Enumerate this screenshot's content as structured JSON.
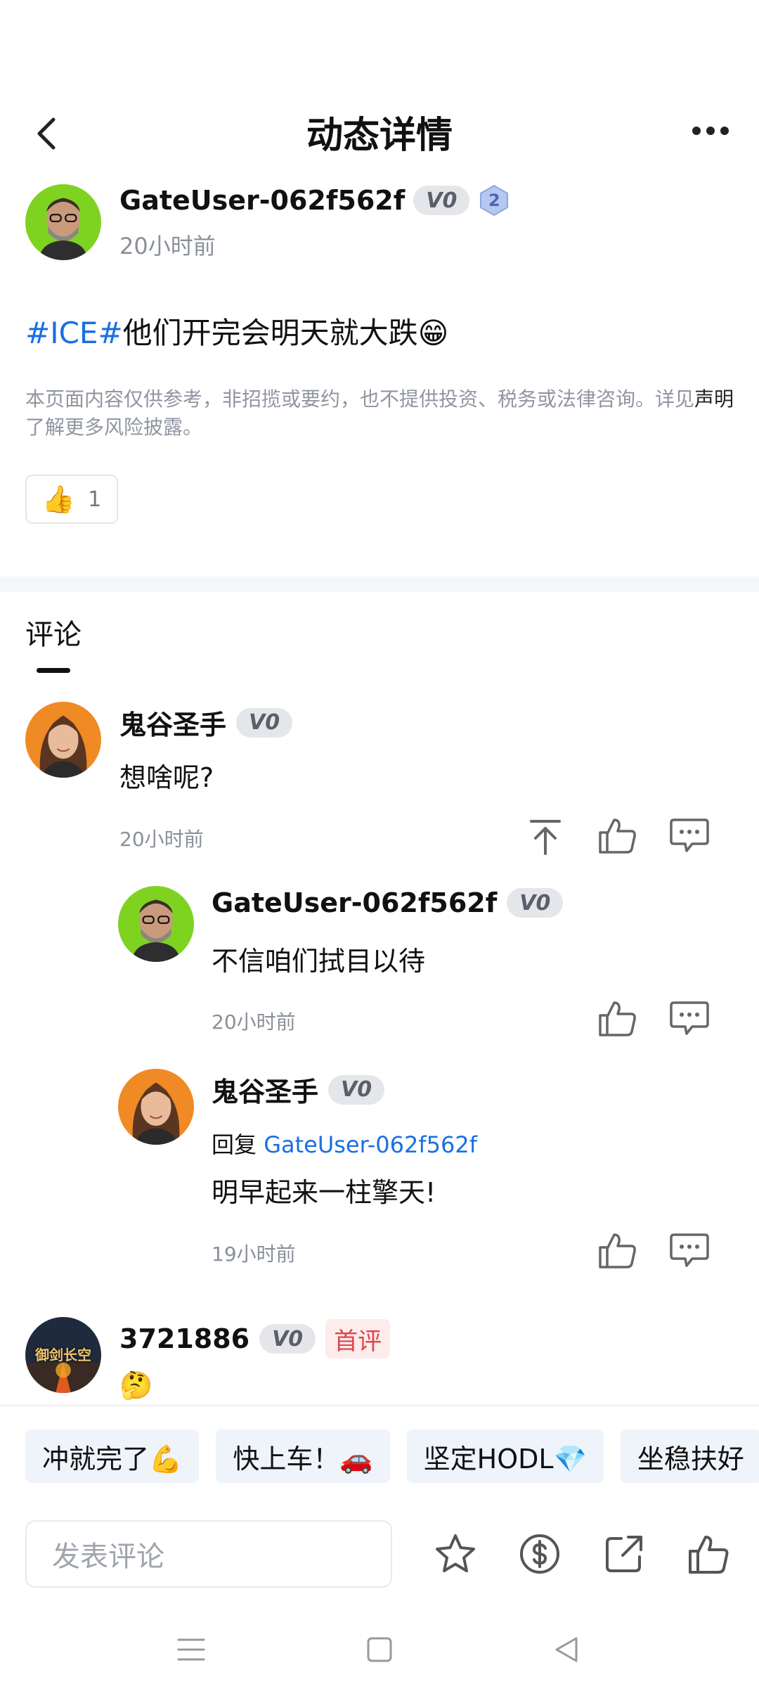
{
  "header": {
    "title": "动态详情"
  },
  "post": {
    "author": "GateUser-062f562f",
    "level": "V0",
    "badge_number": "2",
    "time": "20小时前",
    "tag": "#ICE#",
    "text": "他们开完会明天就大跌",
    "emoji": "😁",
    "disclaimer_before": "本页面内容仅供参考，非招揽或要约，也不提供投资、税务或法律咨询。详见",
    "disclaimer_link": "声明",
    "disclaimer_after": "了解更多风险披露。",
    "like_emoji": "👍",
    "like_count": "1"
  },
  "comments_section": {
    "title": "评论"
  },
  "comments": [
    {
      "user": "鬼谷圣手",
      "level": "V0",
      "text": "想啥呢?",
      "time": "20小时前"
    },
    {
      "user": "GateUser-062f562f",
      "level": "V0",
      "text": "不信咱们拭目以待",
      "time": "20小时前"
    },
    {
      "user": "鬼谷圣手",
      "level": "V0",
      "reply_prefix": "回复",
      "reply_to": "GateUser-062f562f",
      "text": "明早起来一柱擎天!",
      "time": "19小时前"
    },
    {
      "user": "3721886",
      "level": "V0",
      "first_badge": "首评",
      "avatar_text": "御剑长空",
      "text": "🤔"
    }
  ],
  "quick_replies": [
    "冲就完了💪",
    "快上车！🚗",
    "坚定HODL💎",
    "坐稳扶好"
  ],
  "footer": {
    "input_placeholder": "发表评论"
  },
  "colors": {
    "link_blue": "#1a6fe0",
    "first_badge_red": "#e0454c",
    "avatar_green": "#7ed321",
    "avatar_orange": "#f08a24"
  }
}
